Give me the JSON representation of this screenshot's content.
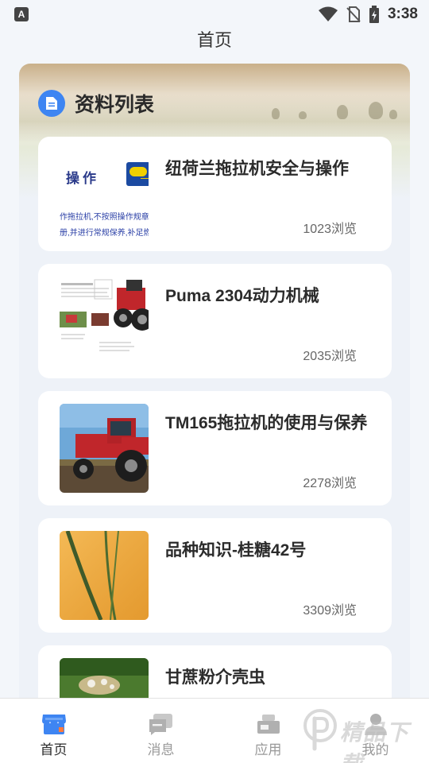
{
  "status_bar": {
    "time": "3:38",
    "left_icon": "A"
  },
  "header": {
    "title": "首页"
  },
  "section": {
    "title": "资料列表"
  },
  "items": [
    {
      "title": "纽荷兰拖拉机安全与操作",
      "views": "1023浏览",
      "thumb": {
        "line1": "操作",
        "line2": "作拖拉机,不按照操作规章操",
        "line3": "册,并进行常规保养,补足燃"
      }
    },
    {
      "title": "Puma 2304动力机械",
      "views": "2035浏览"
    },
    {
      "title": "TM165拖拉机的使用与保养",
      "views": "2278浏览"
    },
    {
      "title": "品种知识-桂糖42号",
      "views": "3309浏览"
    },
    {
      "title": "甘蔗粉介壳虫",
      "views": ""
    }
  ],
  "tabs": [
    {
      "label": "首页",
      "icon": "store-icon",
      "active": true
    },
    {
      "label": "消息",
      "icon": "message-icon",
      "active": false
    },
    {
      "label": "应用",
      "icon": "apps-icon",
      "active": false
    },
    {
      "label": "我的",
      "icon": "profile-icon",
      "active": false
    }
  ],
  "watermark": {
    "text": "精品下载"
  },
  "colors": {
    "accent": "#3e85f2",
    "background": "#f3f6fa",
    "panel": "#eef2f8",
    "tractor_red": "#c0262b"
  }
}
